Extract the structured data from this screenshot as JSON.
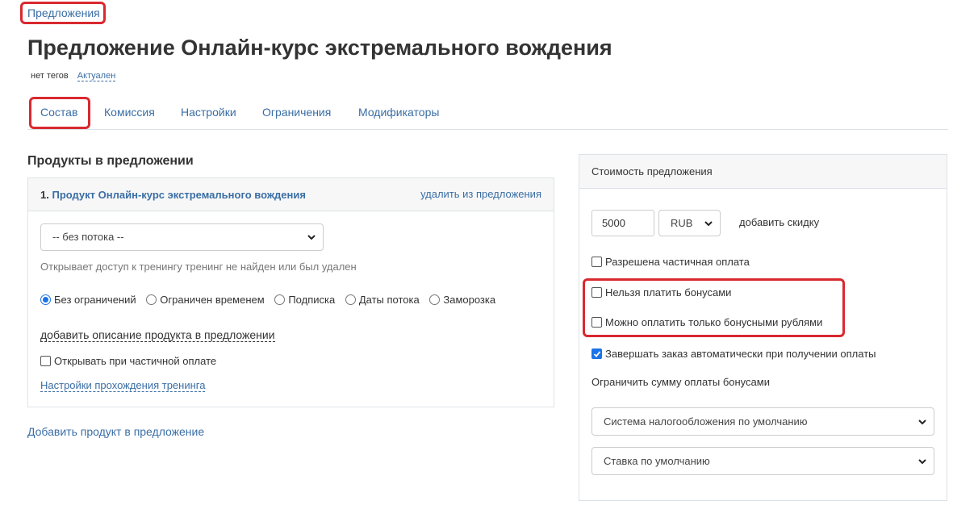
{
  "breadcrumb": "Предложения",
  "page_title": "Предложение Онлайн-курс экстремального вождения",
  "meta": {
    "tags": "нет тегов",
    "status": "Актуален"
  },
  "tabs": [
    {
      "label": "Состав"
    },
    {
      "label": "Комиссия"
    },
    {
      "label": "Настройки"
    },
    {
      "label": "Ограничения"
    },
    {
      "label": "Модификаторы"
    }
  ],
  "products_section": {
    "title": "Продукты в предложении",
    "product": {
      "number": "1.",
      "name": "Продукт Онлайн-курс экстремального вождения",
      "remove_label": "удалить из предложения",
      "stream_select": "-- без потока --",
      "access_hint": "Открывает доступ к тренингу тренинг не найден или был удален",
      "access_options": [
        "Без ограничений",
        "Ограничен временем",
        "Подписка",
        "Даты потока",
        "Заморозка"
      ],
      "selected_access": "Без ограничений",
      "add_description_label": "добавить описание продукта в предложении",
      "open_on_partial_label": "Открывать при частичной оплате",
      "open_on_partial_checked": false,
      "training_settings_label": "Настройки прохождения тренинга"
    },
    "add_product_label": "Добавить продукт в предложение"
  },
  "cost_panel": {
    "title": "Стоимость предложения",
    "price_value": "5000",
    "currency": "RUB",
    "add_discount_label": "добавить скидку",
    "options": [
      {
        "label": "Разрешена частичная оплата",
        "checked": false
      },
      {
        "label": "Нельзя платить бонусами",
        "checked": false
      },
      {
        "label": "Можно оплатить только бонусными рублями",
        "checked": false
      },
      {
        "label": "Завершать заказ автоматически при получении оплаты",
        "checked": true
      }
    ],
    "limit_bonus_label": "Ограничить сумму оплаты бонусами",
    "tax_system": "Система налогообложения по умолчанию",
    "vat_rate": "Ставка по умолчанию"
  },
  "colors": {
    "link": "#3a6ea5",
    "highlight": "#d9292f",
    "accent": "#1a73e8"
  }
}
